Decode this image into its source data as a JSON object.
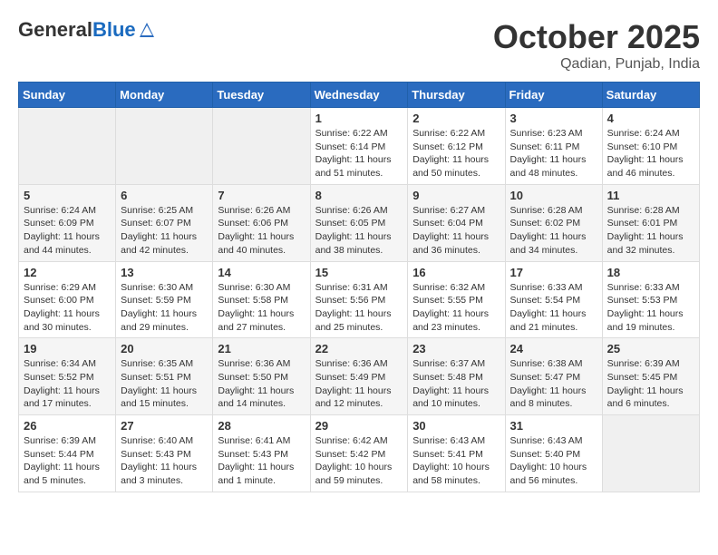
{
  "header": {
    "logo_general": "General",
    "logo_blue": "Blue",
    "month_title": "October 2025",
    "location": "Qadian, Punjab, India"
  },
  "weekdays": [
    "Sunday",
    "Monday",
    "Tuesday",
    "Wednesday",
    "Thursday",
    "Friday",
    "Saturday"
  ],
  "weeks": [
    [
      {
        "day": "",
        "info": ""
      },
      {
        "day": "",
        "info": ""
      },
      {
        "day": "",
        "info": ""
      },
      {
        "day": "1",
        "info": "Sunrise: 6:22 AM\nSunset: 6:14 PM\nDaylight: 11 hours and 51 minutes."
      },
      {
        "day": "2",
        "info": "Sunrise: 6:22 AM\nSunset: 6:12 PM\nDaylight: 11 hours and 50 minutes."
      },
      {
        "day": "3",
        "info": "Sunrise: 6:23 AM\nSunset: 6:11 PM\nDaylight: 11 hours and 48 minutes."
      },
      {
        "day": "4",
        "info": "Sunrise: 6:24 AM\nSunset: 6:10 PM\nDaylight: 11 hours and 46 minutes."
      }
    ],
    [
      {
        "day": "5",
        "info": "Sunrise: 6:24 AM\nSunset: 6:09 PM\nDaylight: 11 hours and 44 minutes."
      },
      {
        "day": "6",
        "info": "Sunrise: 6:25 AM\nSunset: 6:07 PM\nDaylight: 11 hours and 42 minutes."
      },
      {
        "day": "7",
        "info": "Sunrise: 6:26 AM\nSunset: 6:06 PM\nDaylight: 11 hours and 40 minutes."
      },
      {
        "day": "8",
        "info": "Sunrise: 6:26 AM\nSunset: 6:05 PM\nDaylight: 11 hours and 38 minutes."
      },
      {
        "day": "9",
        "info": "Sunrise: 6:27 AM\nSunset: 6:04 PM\nDaylight: 11 hours and 36 minutes."
      },
      {
        "day": "10",
        "info": "Sunrise: 6:28 AM\nSunset: 6:02 PM\nDaylight: 11 hours and 34 minutes."
      },
      {
        "day": "11",
        "info": "Sunrise: 6:28 AM\nSunset: 6:01 PM\nDaylight: 11 hours and 32 minutes."
      }
    ],
    [
      {
        "day": "12",
        "info": "Sunrise: 6:29 AM\nSunset: 6:00 PM\nDaylight: 11 hours and 30 minutes."
      },
      {
        "day": "13",
        "info": "Sunrise: 6:30 AM\nSunset: 5:59 PM\nDaylight: 11 hours and 29 minutes."
      },
      {
        "day": "14",
        "info": "Sunrise: 6:30 AM\nSunset: 5:58 PM\nDaylight: 11 hours and 27 minutes."
      },
      {
        "day": "15",
        "info": "Sunrise: 6:31 AM\nSunset: 5:56 PM\nDaylight: 11 hours and 25 minutes."
      },
      {
        "day": "16",
        "info": "Sunrise: 6:32 AM\nSunset: 5:55 PM\nDaylight: 11 hours and 23 minutes."
      },
      {
        "day": "17",
        "info": "Sunrise: 6:33 AM\nSunset: 5:54 PM\nDaylight: 11 hours and 21 minutes."
      },
      {
        "day": "18",
        "info": "Sunrise: 6:33 AM\nSunset: 5:53 PM\nDaylight: 11 hours and 19 minutes."
      }
    ],
    [
      {
        "day": "19",
        "info": "Sunrise: 6:34 AM\nSunset: 5:52 PM\nDaylight: 11 hours and 17 minutes."
      },
      {
        "day": "20",
        "info": "Sunrise: 6:35 AM\nSunset: 5:51 PM\nDaylight: 11 hours and 15 minutes."
      },
      {
        "day": "21",
        "info": "Sunrise: 6:36 AM\nSunset: 5:50 PM\nDaylight: 11 hours and 14 minutes."
      },
      {
        "day": "22",
        "info": "Sunrise: 6:36 AM\nSunset: 5:49 PM\nDaylight: 11 hours and 12 minutes."
      },
      {
        "day": "23",
        "info": "Sunrise: 6:37 AM\nSunset: 5:48 PM\nDaylight: 11 hours and 10 minutes."
      },
      {
        "day": "24",
        "info": "Sunrise: 6:38 AM\nSunset: 5:47 PM\nDaylight: 11 hours and 8 minutes."
      },
      {
        "day": "25",
        "info": "Sunrise: 6:39 AM\nSunset: 5:45 PM\nDaylight: 11 hours and 6 minutes."
      }
    ],
    [
      {
        "day": "26",
        "info": "Sunrise: 6:39 AM\nSunset: 5:44 PM\nDaylight: 11 hours and 5 minutes."
      },
      {
        "day": "27",
        "info": "Sunrise: 6:40 AM\nSunset: 5:43 PM\nDaylight: 11 hours and 3 minutes."
      },
      {
        "day": "28",
        "info": "Sunrise: 6:41 AM\nSunset: 5:43 PM\nDaylight: 11 hours and 1 minute."
      },
      {
        "day": "29",
        "info": "Sunrise: 6:42 AM\nSunset: 5:42 PM\nDaylight: 10 hours and 59 minutes."
      },
      {
        "day": "30",
        "info": "Sunrise: 6:43 AM\nSunset: 5:41 PM\nDaylight: 10 hours and 58 minutes."
      },
      {
        "day": "31",
        "info": "Sunrise: 6:43 AM\nSunset: 5:40 PM\nDaylight: 10 hours and 56 minutes."
      },
      {
        "day": "",
        "info": ""
      }
    ]
  ]
}
